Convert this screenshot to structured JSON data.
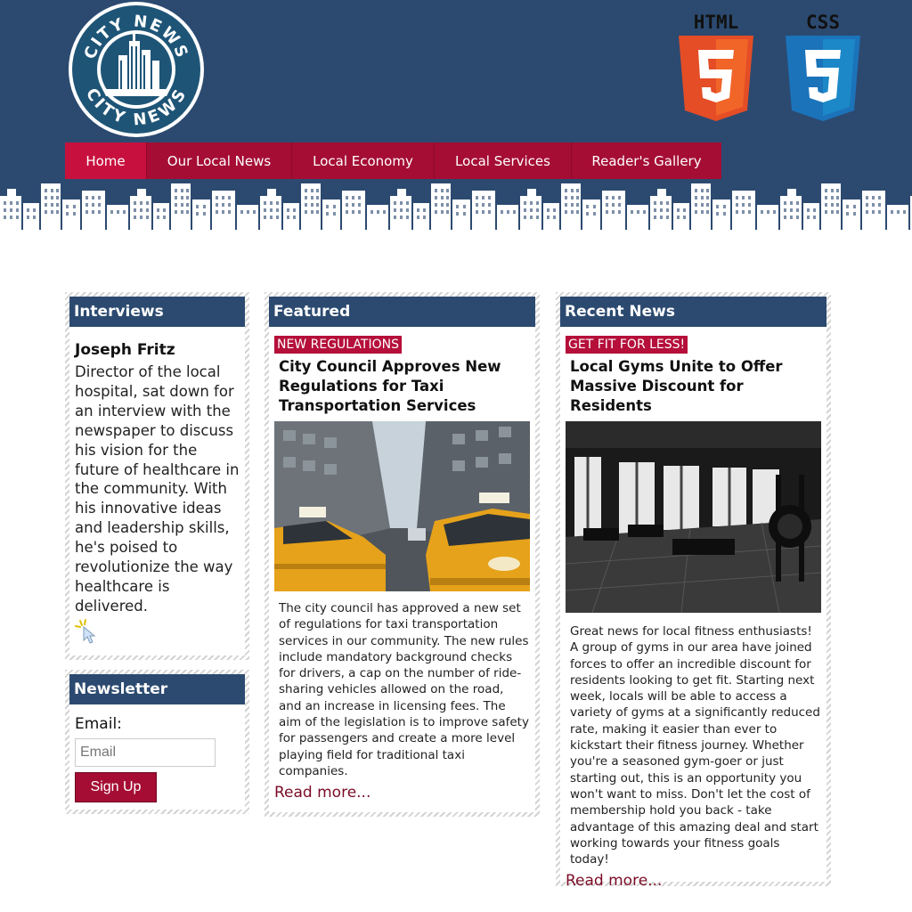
{
  "brand": {
    "logo_text_top": "CITY NEWS",
    "logo_text_bottom": "CITY NEWS",
    "html_label": "HTML",
    "css_label": "CSS",
    "accent": "#a50d34",
    "navy": "#2c4a70"
  },
  "nav": {
    "items": [
      {
        "label": "Home"
      },
      {
        "label": "Our Local News"
      },
      {
        "label": "Local Economy"
      },
      {
        "label": "Local Services"
      },
      {
        "label": "Reader's Gallery"
      }
    ]
  },
  "interviews": {
    "heading": "Interviews",
    "name": "Joseph Fritz",
    "text": "Director of the local hospital, sat down for an interview with the newspaper to discuss his vision for the future of healthcare in the community. With his innovative ideas and leadership skills, he's poised to revolutionize the way healthcare is delivered."
  },
  "newsletter": {
    "heading": "Newsletter",
    "email_label": "Email:",
    "email_placeholder": "Email",
    "button": "Sign Up"
  },
  "featured": {
    "heading": "Featured",
    "tag": "NEW REGULATIONS",
    "title": "City Council Approves New Regulations for Taxi Transportation Services",
    "body": "The city council has approved a new set of regulations for taxi transportation services in our community. The new rules include mandatory background checks for drivers, a cap on the number of ride-sharing vehicles allowed on the road, and an increase in licensing fees. The aim of the legislation is to improve safety for passengers and create a more level playing field for traditional taxi companies.",
    "read_more": "Read more..."
  },
  "recent": {
    "heading": "Recent News",
    "tag": "GET FIT FOR LESS!",
    "title": "Local Gyms Unite to Offer Massive Discount for Residents",
    "body": "Great news for local fitness enthusiasts! A group of gyms in our area have joined forces to offer an incredible discount for residents looking to get fit. Starting next week, locals will be able to access a variety of gyms at a significantly reduced rate, making it easier than ever to kickstart their fitness journey. Whether you're a seasoned gym-goer or just starting out, this is an opportunity you won't want to miss. Don't let the cost of membership hold you back - take advantage of this amazing deal and start working towards your fitness goals today!",
    "read_more": "Read more..."
  }
}
